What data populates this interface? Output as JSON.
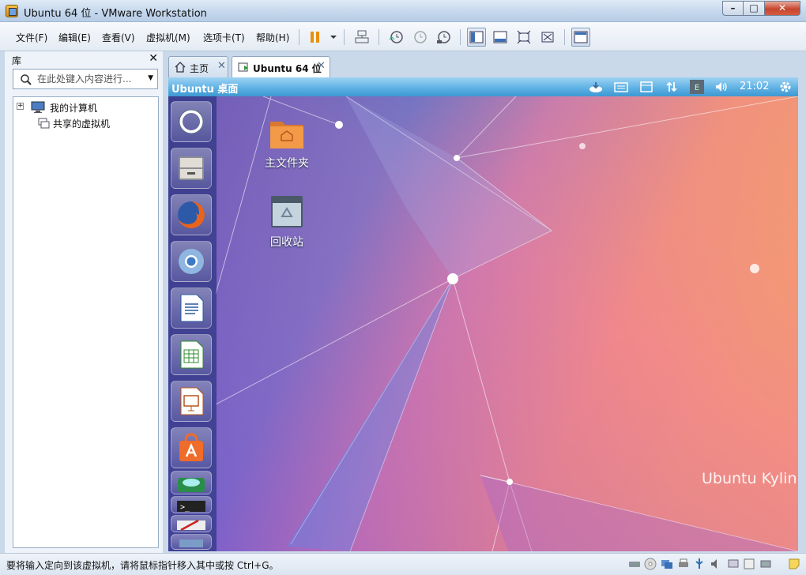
{
  "window": {
    "title": "Ubuntu 64 位 - VMware Workstation"
  },
  "menu": {
    "items": [
      {
        "label": "文件(F)"
      },
      {
        "label": "编辑(E)"
      },
      {
        "label": "查看(V)"
      },
      {
        "label": "虚拟机(M)"
      },
      {
        "label": "选项卡(T)"
      },
      {
        "label": "帮助(H)"
      }
    ]
  },
  "library": {
    "title": "库",
    "search_placeholder": "在此处键入内容进行...",
    "tree": [
      {
        "label": "我的计算机"
      },
      {
        "label": "共享的虚拟机"
      }
    ]
  },
  "tabs": [
    {
      "label": "主页"
    },
    {
      "label": "Ubuntu 64 位"
    }
  ],
  "vm": {
    "panel_title": "Ubuntu 桌面",
    "clock": "21:02",
    "desktop_icons": [
      {
        "label": "主文件夹",
        "icon": "home-folder-icon"
      },
      {
        "label": "回收站",
        "icon": "trash-icon"
      }
    ],
    "watermark": "Ubuntu Kylin",
    "launcher_items": [
      "dash-icon",
      "file-manager-icon",
      "firefox-icon",
      "chromium-icon",
      "writer-icon",
      "calc-icon",
      "impress-icon",
      "software-center-icon",
      "stacked-apps-icon"
    ]
  },
  "status": {
    "message": "要将输入定向到该虚拟机，请将鼠标指针移入其中或按 Ctrl+G。"
  },
  "colors": {
    "accent": "#3d98d2",
    "desktop_blue": "#1d51c7",
    "desktop_orange": "#e9936f"
  }
}
